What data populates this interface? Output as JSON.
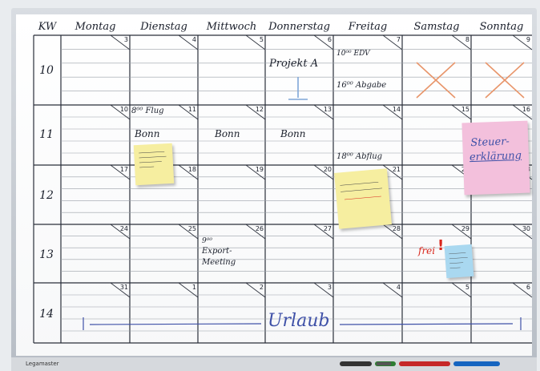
{
  "header": {
    "kw": "KW",
    "days": [
      "Montag",
      "Dienstag",
      "Mittwoch",
      "Donnerstag",
      "Freitag",
      "Samstag",
      "Sonntag"
    ]
  },
  "weeks": [
    {
      "kw": "10",
      "dates": [
        "3",
        "4",
        "5",
        "6",
        "7",
        "8",
        "9"
      ]
    },
    {
      "kw": "11",
      "dates": [
        "10",
        "11",
        "12",
        "13",
        "14",
        "15",
        "16"
      ]
    },
    {
      "kw": "12",
      "dates": [
        "17",
        "18",
        "19",
        "20",
        "21",
        "22",
        "23"
      ]
    },
    {
      "kw": "13",
      "dates": [
        "24",
        "25",
        "26",
        "27",
        "28",
        "29",
        "30"
      ]
    },
    {
      "kw": "14",
      "dates": [
        "31",
        "1",
        "2",
        "3",
        "4",
        "5",
        "6"
      ]
    }
  ],
  "entries": {
    "projekt_a": "Projekt A",
    "edv": "10⁰⁰ EDV",
    "abgabe": "16⁰⁰ Abgabe",
    "flug": "8⁰⁰ Flug",
    "bonn_di": "Bonn",
    "bonn_mi": "Bonn",
    "bonn_do": "Bonn",
    "abflug": "18⁰⁰ Abflug",
    "export_meeting_time": "9⁰⁰",
    "export_meeting_l1": "Export-",
    "export_meeting_l2": "Meeting",
    "frei": "frei",
    "frei_mark": "!",
    "urlaub": "Urlaub"
  },
  "stickies": {
    "steuer_l1": "Steuer-",
    "steuer_l2": "erklärung"
  },
  "brand": "Legamaster",
  "colors": {
    "ink": "#1a1f2b",
    "cross": "#e8956a",
    "sticky_yellow": "#f6eea0",
    "sticky_pink": "#f3c0dc",
    "sticky_blue": "#a9d8f0",
    "frei_red": "#d9261c",
    "urlaub_blue": "#3f51a8"
  }
}
